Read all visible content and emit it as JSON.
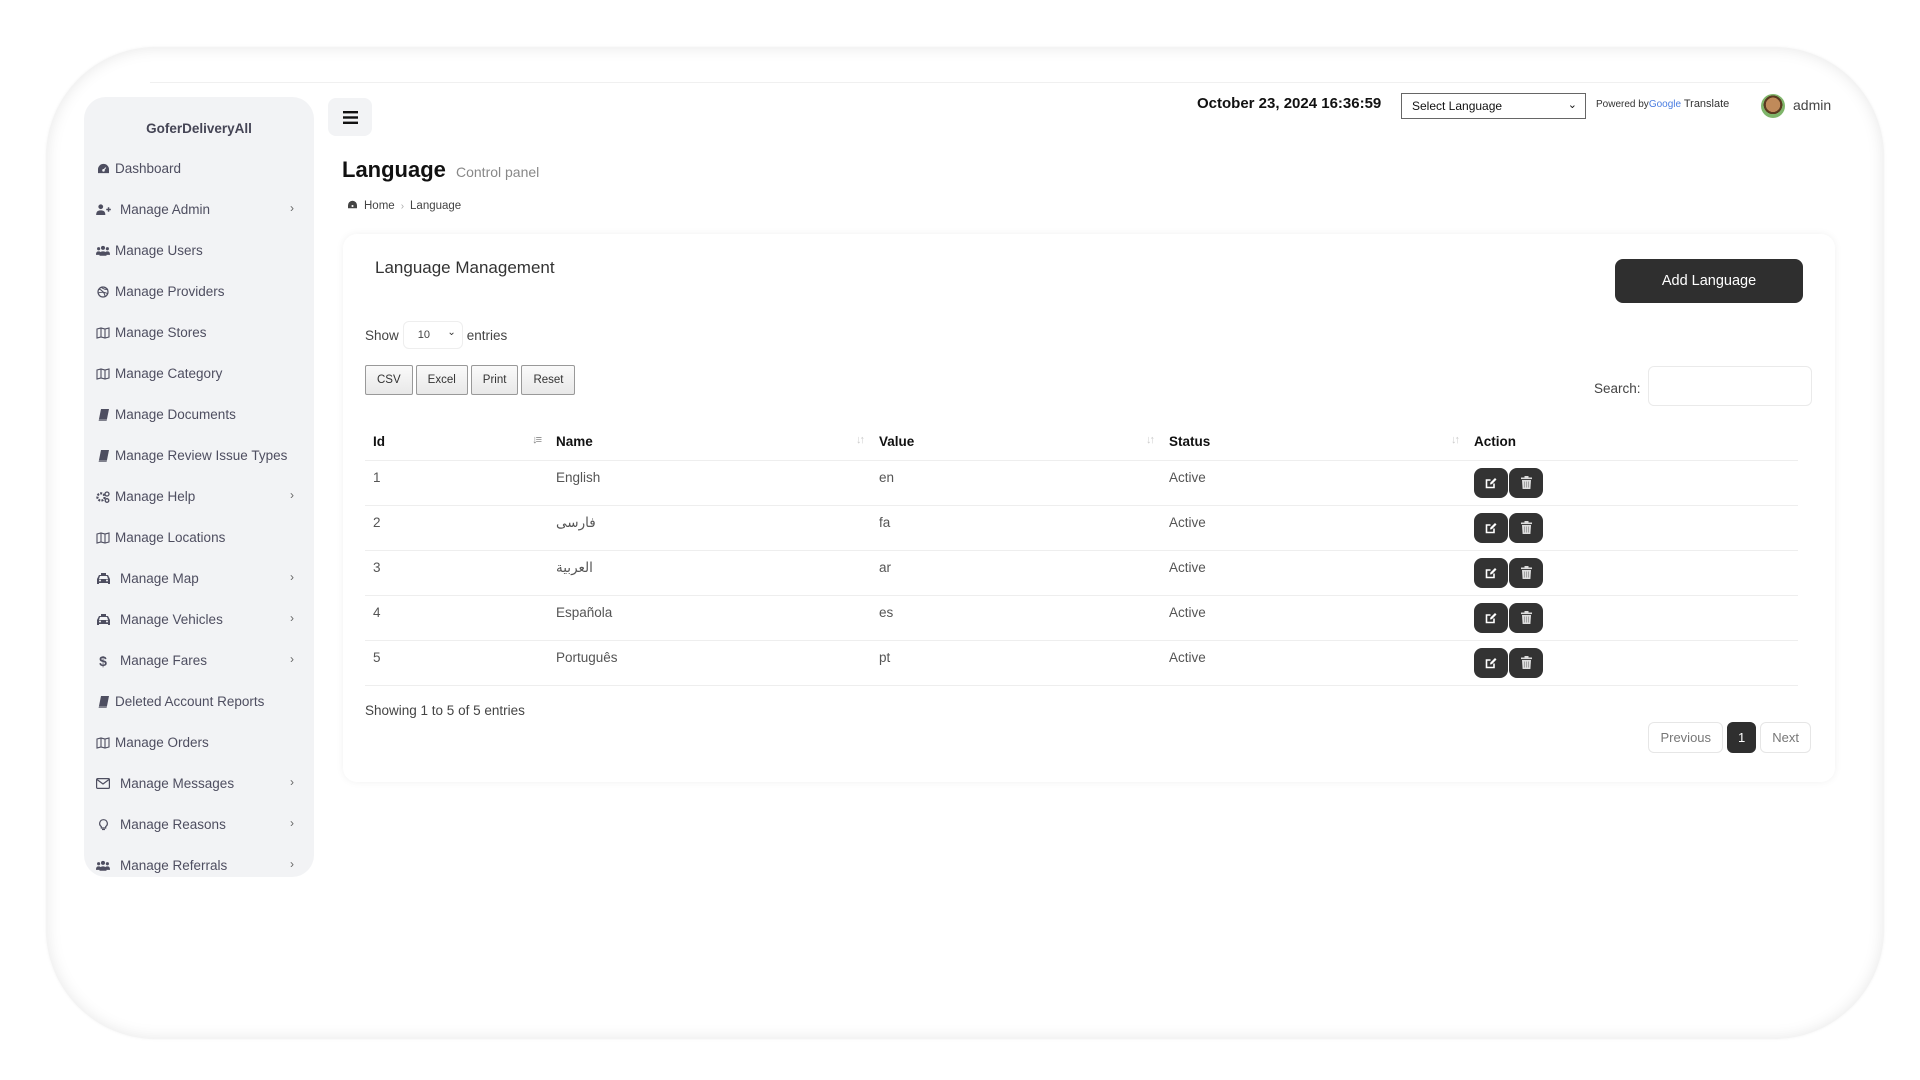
{
  "app": {
    "brand": "GoferDeliveryAll"
  },
  "sidebar": {
    "items": [
      {
        "label": "Dashboard",
        "icon": "dashboard-icon",
        "has_submenu": false
      },
      {
        "label": "Manage Admin",
        "icon": "user-plus-icon",
        "has_submenu": true
      },
      {
        "label": "Manage Users",
        "icon": "users-icon",
        "has_submenu": false
      },
      {
        "label": "Manage Providers",
        "icon": "dribbble-icon",
        "has_submenu": false
      },
      {
        "label": "Manage Stores",
        "icon": "map-icon",
        "has_submenu": false
      },
      {
        "label": "Manage Category",
        "icon": "map-icon",
        "has_submenu": false
      },
      {
        "label": "Manage Documents",
        "icon": "book-icon",
        "has_submenu": false
      },
      {
        "label": "Manage Review Issue Types",
        "icon": "book-icon",
        "has_submenu": false
      },
      {
        "label": "Manage Help",
        "icon": "cogs-icon",
        "has_submenu": true
      },
      {
        "label": "Manage Locations",
        "icon": "map-icon",
        "has_submenu": false
      },
      {
        "label": "Manage Map",
        "icon": "taxi-icon",
        "has_submenu": true
      },
      {
        "label": "Manage Vehicles",
        "icon": "taxi-icon",
        "has_submenu": true
      },
      {
        "label": "Manage Fares",
        "icon": "dollar-icon",
        "has_submenu": true
      },
      {
        "label": "Deleted Account Reports",
        "icon": "book-icon",
        "has_submenu": false
      },
      {
        "label": "Manage Orders",
        "icon": "map-icon",
        "has_submenu": false
      },
      {
        "label": "Manage Messages",
        "icon": "envelope-icon",
        "has_submenu": true
      },
      {
        "label": "Manage Reasons",
        "icon": "lightbulb-icon",
        "has_submenu": true
      },
      {
        "label": "Manage Referrals",
        "icon": "users-icon",
        "has_submenu": true
      }
    ],
    "chevron": "›"
  },
  "header": {
    "datetime": "October 23, 2024 16:36:59",
    "language_select": "Select Language",
    "powered_by": "Powered by",
    "google": "Google",
    "translate": "Translate",
    "user": "admin"
  },
  "page": {
    "title": "Language",
    "subtitle": "Control panel",
    "breadcrumb": {
      "home": "Home",
      "separator": "›",
      "current": "Language"
    }
  },
  "card": {
    "title": "Language Management",
    "add_button": "Add Language",
    "show_label": "Show",
    "entries_value": "10",
    "entries_label": "entries",
    "export_buttons": [
      "CSV",
      "Excel",
      "Print",
      "Reset"
    ],
    "search_label": "Search:",
    "search_value": "",
    "columns": [
      "Id",
      "Name",
      "Value",
      "Status",
      "Action"
    ],
    "rows": [
      {
        "id": "1",
        "name": "English",
        "value": "en",
        "status": "Active"
      },
      {
        "id": "2",
        "name": "فارسی",
        "value": "fa",
        "status": "Active"
      },
      {
        "id": "3",
        "name": "العربية",
        "value": "ar",
        "status": "Active"
      },
      {
        "id": "4",
        "name": "Española",
        "value": "es",
        "status": "Active"
      },
      {
        "id": "5",
        "name": "Português",
        "value": "pt",
        "status": "Active"
      }
    ],
    "info": "Showing 1 to 5 of 5 entries",
    "pagination": {
      "previous": "Previous",
      "current": "1",
      "next": "Next"
    }
  },
  "colors": {
    "primary_dark": "#2f2f2f",
    "sidebar_bg": "#f2f3f5"
  }
}
